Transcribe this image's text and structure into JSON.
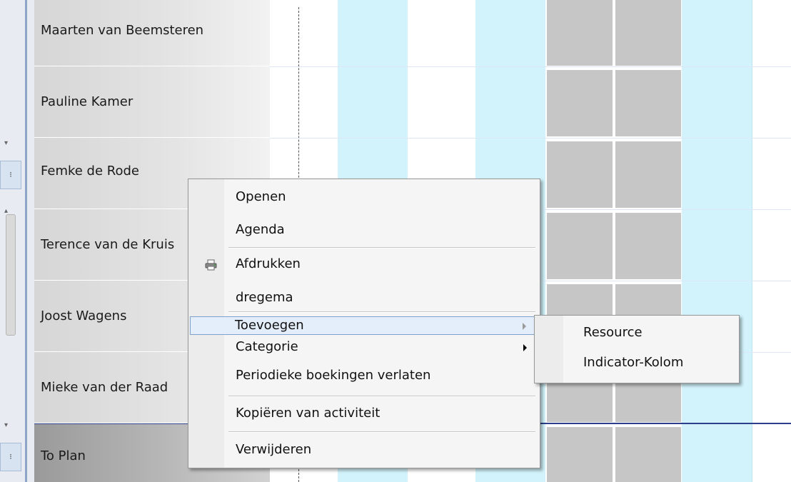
{
  "resources": [
    {
      "name": "Maarten van Beemsteren"
    },
    {
      "name": "Pauline Kamer"
    },
    {
      "name": "Femke de Rode"
    },
    {
      "name": "Terence van de Kruis"
    },
    {
      "name": "Joost Wagens"
    },
    {
      "name": "Mieke van der Raad"
    },
    {
      "name": "To Plan"
    }
  ],
  "context_menu": {
    "items": [
      {
        "label": "Openen"
      },
      {
        "label": "Agenda"
      },
      {
        "label": "Afdrukken",
        "icon": "printer-icon"
      },
      {
        "label": "dregema"
      },
      {
        "label": "Toevoegen",
        "has_submenu": true,
        "highlighted": true
      },
      {
        "label": "Categorie",
        "has_submenu": true
      },
      {
        "label": "Periodieke boekingen verlaten"
      },
      {
        "label": "Kopiëren van activiteit"
      },
      {
        "label": "Verwijderen"
      }
    ]
  },
  "submenu": {
    "items": [
      {
        "label": "Resource"
      },
      {
        "label": "Indicator-Kolom"
      }
    ]
  },
  "colors": {
    "weekend_column": "#d2f3fb",
    "unavailable_cell": "#c6c6c6",
    "menu_highlight": "#e4eefa",
    "selection_line": "#2b3f8a"
  }
}
